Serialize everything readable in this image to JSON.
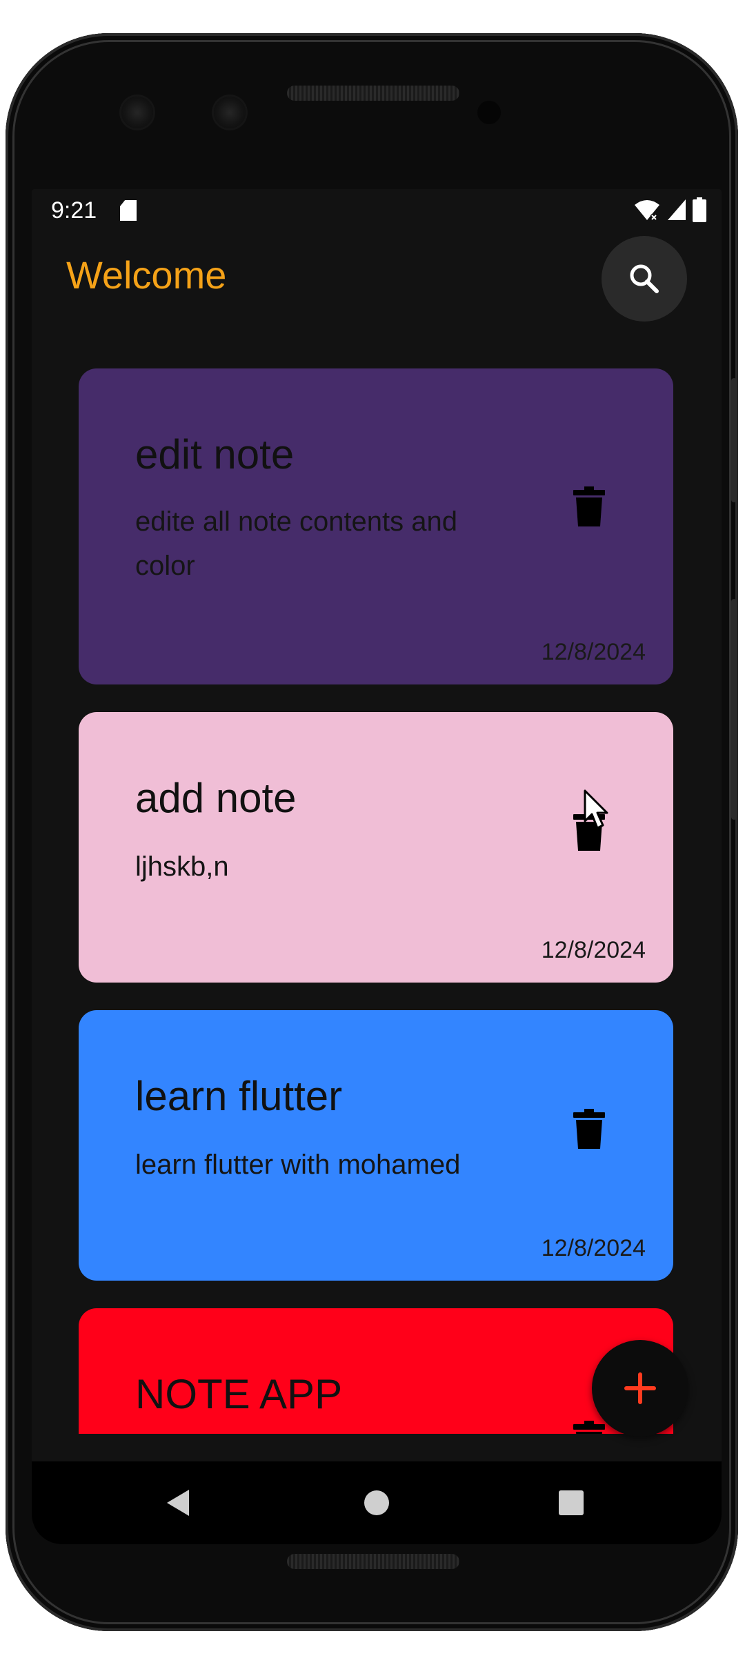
{
  "status_bar": {
    "time": "9:21"
  },
  "app_bar": {
    "title": "Welcome",
    "title_color": "#f5a218",
    "search_icon": "search-icon"
  },
  "notes": [
    {
      "title": "edit note",
      "body": "edite all note contents and color",
      "date": "12/8/2024",
      "color": "#462c6a"
    },
    {
      "title": "add note",
      "body": "ljhskb,n",
      "date": "12/8/2024",
      "color": "#f0bed6"
    },
    {
      "title": "learn flutter",
      "body": "learn flutter with mohamed",
      "date": "12/8/2024",
      "color": "#3385ff"
    },
    {
      "title": "NOTE APP",
      "color": "#ff0019"
    }
  ],
  "fab": {
    "icon": "plus-icon",
    "icon_color": "#ff3b1f"
  },
  "nav_bar": {
    "back_icon": "back-icon",
    "home_icon": "home-icon",
    "recents_icon": "recents-icon"
  }
}
